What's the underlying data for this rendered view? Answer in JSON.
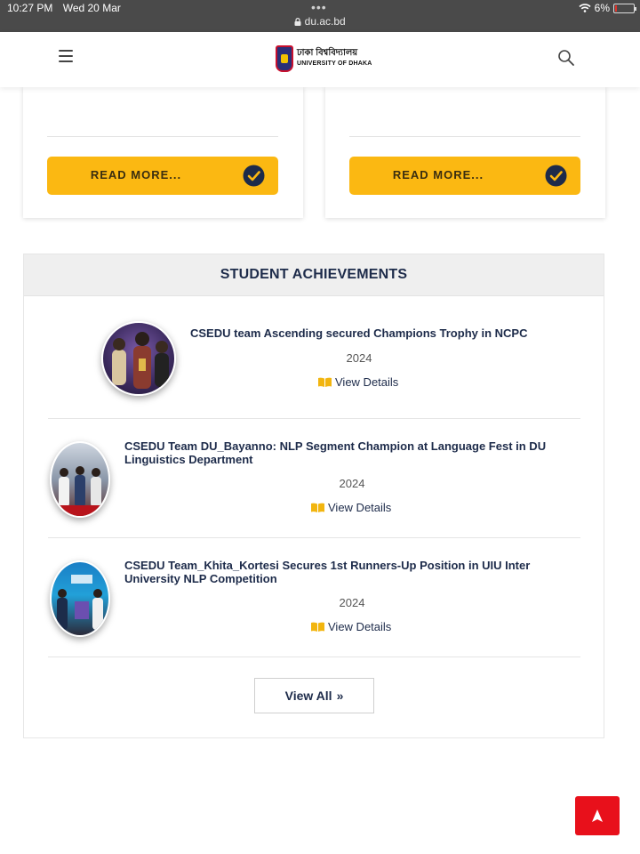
{
  "status_bar": {
    "time": "10:27 PM",
    "date": "Wed 20 Mar",
    "url": "du.ac.bd",
    "battery": "6%"
  },
  "header": {
    "logo_bn": "ঢাকা বিশ্ববিদ্যালয়",
    "logo_en": "UNIVERSITY OF DHAKA"
  },
  "cards": [
    {
      "read_more": "READ MORE..."
    },
    {
      "read_more": "READ MORE..."
    }
  ],
  "achievements": {
    "title": "STUDENT ACHIEVEMENTS",
    "items": [
      {
        "title": "CSEDU team Ascending secured Champions Trophy in NCPC",
        "year": "2024",
        "link": "View Details"
      },
      {
        "title": "CSEDU Team DU_Bayanno: NLP Segment Champion at Language Fest in DU Linguistics Department",
        "year": "2024",
        "link": "View Details"
      },
      {
        "title": "CSEDU Team_Khita_Kortesi Secures 1st Runners-Up Position in UIU Inter University NLP Competition",
        "year": "2024",
        "link": "View Details"
      }
    ],
    "view_all": "View All"
  },
  "colors": {
    "accent_yellow": "#fbb812",
    "navy": "#1d2b4a",
    "back_to_top": "#e8101b"
  }
}
